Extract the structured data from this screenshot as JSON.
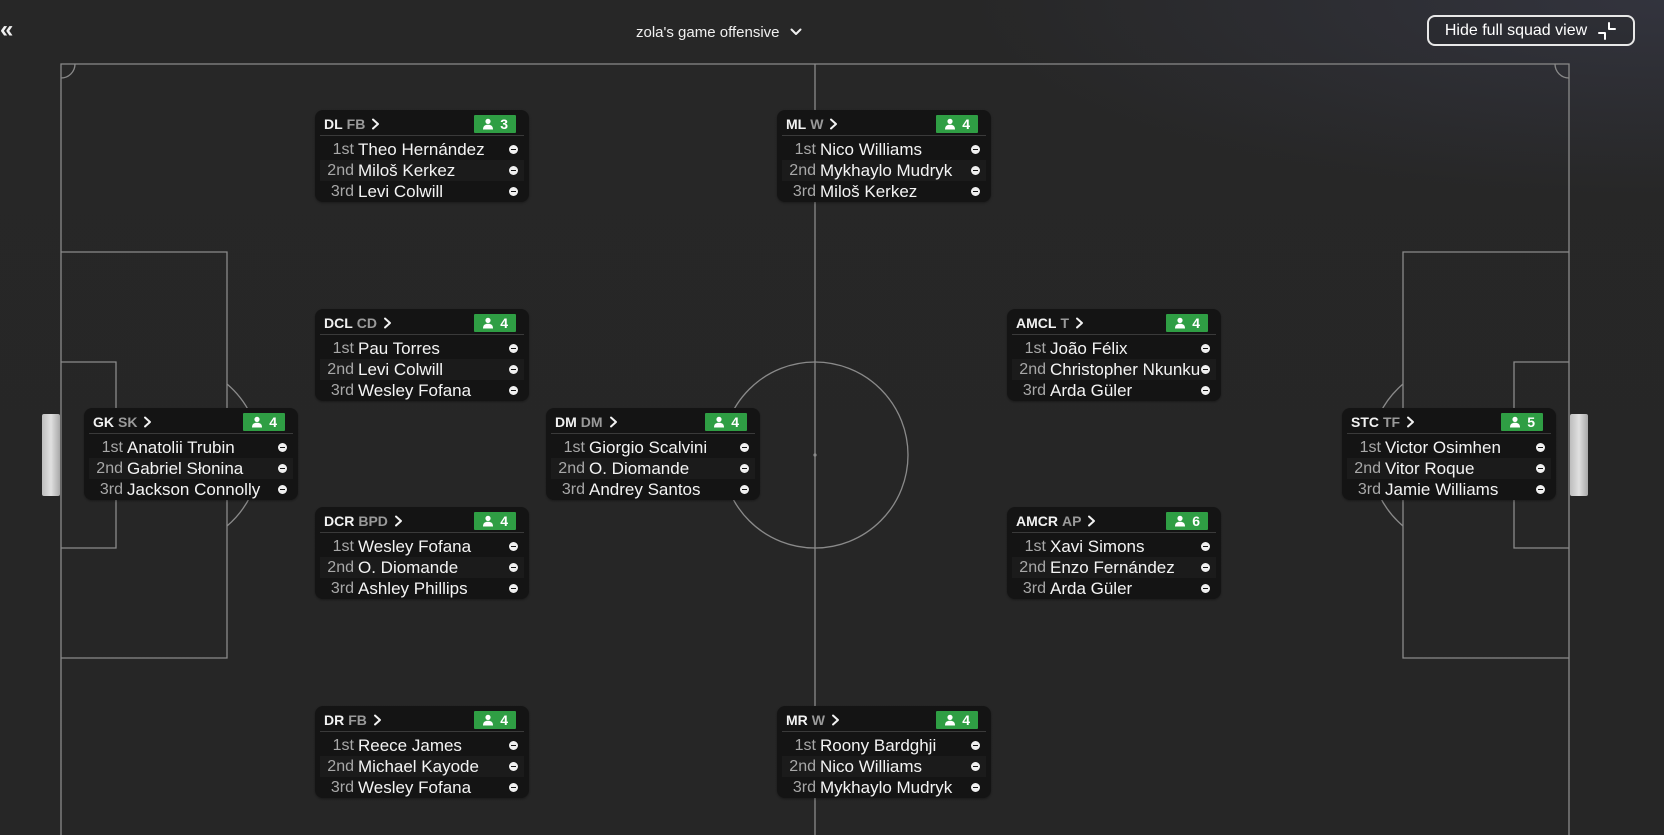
{
  "header": {
    "back_glyph": "«",
    "tactic_name": "zola's game offensive",
    "squad_view_label": "Hide full squad view",
    "squad_view_icon": "minimize-icon"
  },
  "colors": {
    "count_badge": "#2f9e44",
    "pitch_line": "#8a8a8a",
    "card_bg": "#141414"
  },
  "positions": [
    {
      "id": "dl",
      "pos": "DL",
      "role": "FB",
      "count": "3",
      "players": [
        {
          "rank": "1st",
          "name": "Theo Hernández"
        },
        {
          "rank": "2nd",
          "name": "Miloš Kerkez"
        },
        {
          "rank": "3rd",
          "name": "Levi Colwill"
        }
      ]
    },
    {
      "id": "ml",
      "pos": "ML",
      "role": "W",
      "count": "4",
      "players": [
        {
          "rank": "1st",
          "name": "Nico Williams"
        },
        {
          "rank": "2nd",
          "name": "Mykhaylo Mudryk"
        },
        {
          "rank": "3rd",
          "name": "Miloš Kerkez"
        }
      ]
    },
    {
      "id": "dcl",
      "pos": "DCL",
      "role": "CD",
      "count": "4",
      "players": [
        {
          "rank": "1st",
          "name": "Pau Torres"
        },
        {
          "rank": "2nd",
          "name": "Levi Colwill"
        },
        {
          "rank": "3rd",
          "name": "Wesley Fofana"
        }
      ]
    },
    {
      "id": "amcl",
      "pos": "AMCL",
      "role": "T",
      "count": "4",
      "players": [
        {
          "rank": "1st",
          "name": "João Félix"
        },
        {
          "rank": "2nd",
          "name": "Christopher Nkunku"
        },
        {
          "rank": "3rd",
          "name": "Arda Güler"
        }
      ]
    },
    {
      "id": "gk",
      "pos": "GK",
      "role": "SK",
      "count": "4",
      "players": [
        {
          "rank": "1st",
          "name": "Anatolii Trubin"
        },
        {
          "rank": "2nd",
          "name": "Gabriel Słonina"
        },
        {
          "rank": "3rd",
          "name": "Jackson Connolly"
        }
      ]
    },
    {
      "id": "dm",
      "pos": "DM",
      "role": "DM",
      "count": "4",
      "players": [
        {
          "rank": "1st",
          "name": "Giorgio Scalvini"
        },
        {
          "rank": "2nd",
          "name": "O. Diomande"
        },
        {
          "rank": "3rd",
          "name": "Andrey Santos"
        }
      ]
    },
    {
      "id": "stc",
      "pos": "STC",
      "role": "TF",
      "count": "5",
      "players": [
        {
          "rank": "1st",
          "name": "Victor Osimhen"
        },
        {
          "rank": "2nd",
          "name": "Vitor Roque"
        },
        {
          "rank": "3rd",
          "name": "Jamie Williams"
        }
      ]
    },
    {
      "id": "dcr",
      "pos": "DCR",
      "role": "BPD",
      "count": "4",
      "players": [
        {
          "rank": "1st",
          "name": "Wesley Fofana"
        },
        {
          "rank": "2nd",
          "name": "O. Diomande"
        },
        {
          "rank": "3rd",
          "name": "Ashley Phillips"
        }
      ]
    },
    {
      "id": "amcr",
      "pos": "AMCR",
      "role": "AP",
      "count": "6",
      "players": [
        {
          "rank": "1st",
          "name": "Xavi Simons"
        },
        {
          "rank": "2nd",
          "name": "Enzo Fernández"
        },
        {
          "rank": "3rd",
          "name": "Arda Güler"
        }
      ]
    },
    {
      "id": "dr",
      "pos": "DR",
      "role": "FB",
      "count": "4",
      "players": [
        {
          "rank": "1st",
          "name": "Reece James"
        },
        {
          "rank": "2nd",
          "name": "Michael Kayode"
        },
        {
          "rank": "3rd",
          "name": "Wesley Fofana"
        }
      ]
    },
    {
      "id": "mr",
      "pos": "MR",
      "role": "W",
      "count": "4",
      "players": [
        {
          "rank": "1st",
          "name": "Roony Bardghji"
        },
        {
          "rank": "2nd",
          "name": "Nico Williams"
        },
        {
          "rank": "3rd",
          "name": "Mykhaylo Mudryk"
        }
      ]
    }
  ]
}
